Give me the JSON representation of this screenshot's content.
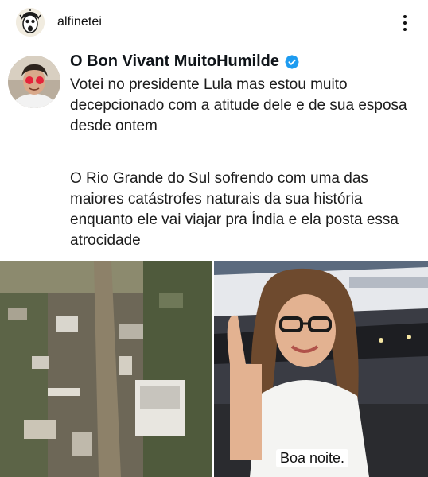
{
  "post": {
    "username": "alfinetei",
    "more_icon": "more-vertical-icon"
  },
  "tweet": {
    "author": "O Bon Vivant MuitoHumilde",
    "verified_icon": "verified-badge-icon",
    "paragraphs": [
      "Votei no presidente Lula mas estou muito decepcionado com a atitude dele e de sua esposa desde ontem",
      "O Rio Grande do Sul sofrendo com uma das maiores catástrofes naturais da sua história enquanto ele vai viajar pra Índia e ela posta essa atrocidade"
    ]
  },
  "media": {
    "right_caption": "Boa noite."
  },
  "colors": {
    "verified": "#1d9bf0",
    "text": "#1c1c1c"
  }
}
